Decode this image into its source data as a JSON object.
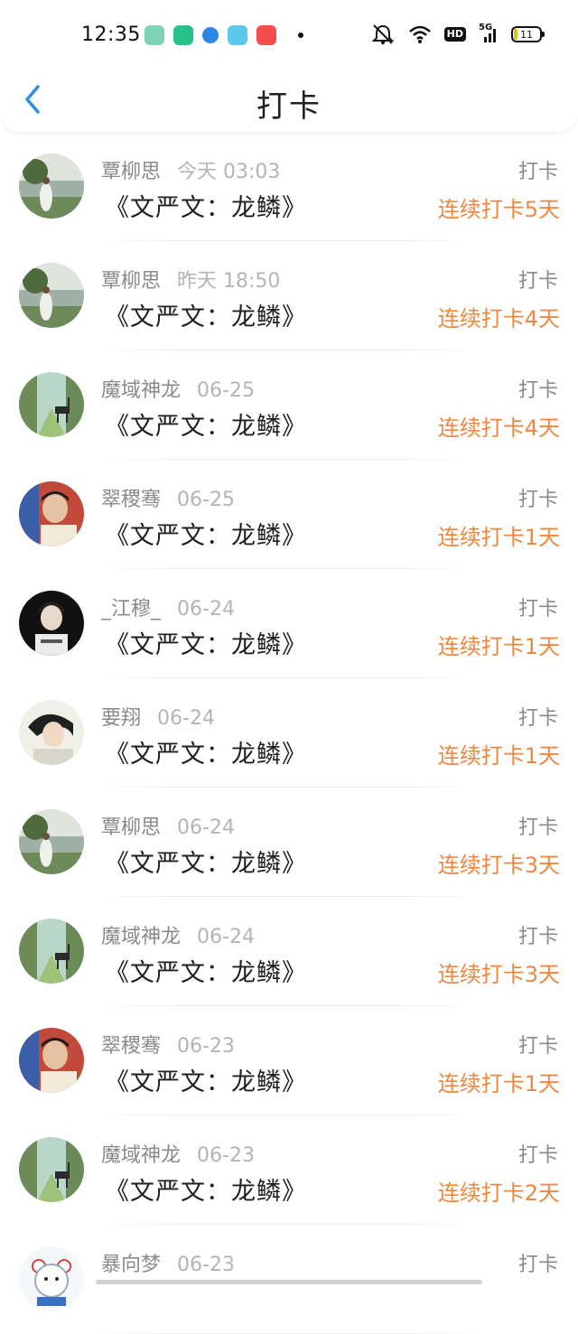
{
  "status_bar": {
    "time": "12:35",
    "battery": "11",
    "network_hd": "HD",
    "network_5g": "5G",
    "app_icon_colors": [
      "#7fd3b8",
      "#27c28a",
      "#2c86e6",
      "#5bc9ea",
      "#f44d4d"
    ]
  },
  "nav": {
    "title": "打卡"
  },
  "entries": [
    {
      "name": "覃柳思",
      "time": "今天 03:03",
      "book": "《文严文：龙鳞》",
      "action": "打卡",
      "streak": "连续打卡5天",
      "avatar": "lake-figure-avatar"
    },
    {
      "name": "覃柳思",
      "time": "昨天 18:50",
      "book": "《文严文：龙鳞》",
      "action": "打卡",
      "streak": "连续打卡4天",
      "avatar": "lake-figure-avatar"
    },
    {
      "name": "魔域神龙",
      "time": "06-25",
      "book": "《文严文：龙鳞》",
      "action": "打卡",
      "streak": "连续打卡4天",
      "avatar": "deer-forest-avatar"
    },
    {
      "name": "翠稷骞",
      "time": "06-25",
      "book": "《文严文：龙鳞》",
      "action": "打卡",
      "streak": "连续打卡1天",
      "avatar": "boy-portrait-avatar"
    },
    {
      "name": "_江穆_",
      "time": "06-24",
      "book": "《文严文：龙鳞》",
      "action": "打卡",
      "streak": "连续打卡1天",
      "avatar": "dark-portrait-avatar"
    },
    {
      "name": "要翔",
      "time": "06-24",
      "book": "《文严文：龙鳞》",
      "action": "打卡",
      "streak": "连续打卡1天",
      "avatar": "light-portrait-avatar"
    },
    {
      "name": "覃柳思",
      "time": "06-24",
      "book": "《文严文：龙鳞》",
      "action": "打卡",
      "streak": "连续打卡3天",
      "avatar": "lake-figure-avatar"
    },
    {
      "name": "魔域神龙",
      "time": "06-24",
      "book": "《文严文：龙鳞》",
      "action": "打卡",
      "streak": "连续打卡3天",
      "avatar": "deer-forest-avatar"
    },
    {
      "name": "翠稷骞",
      "time": "06-23",
      "book": "《文严文：龙鳞》",
      "action": "打卡",
      "streak": "连续打卡1天",
      "avatar": "boy-portrait-avatar"
    },
    {
      "name": "魔域神龙",
      "time": "06-23",
      "book": "《文严文：龙鳞》",
      "action": "打卡",
      "streak": "连续打卡2天",
      "avatar": "deer-forest-avatar"
    },
    {
      "name": "暴向梦",
      "time": "06-23",
      "book": "",
      "action": "打卡",
      "streak": "",
      "avatar": "cartoon-bear-avatar"
    }
  ],
  "colors": {
    "streak": "#f0873e",
    "back_arrow": "#2f8de4",
    "muted_text": "#8a8a8a"
  }
}
